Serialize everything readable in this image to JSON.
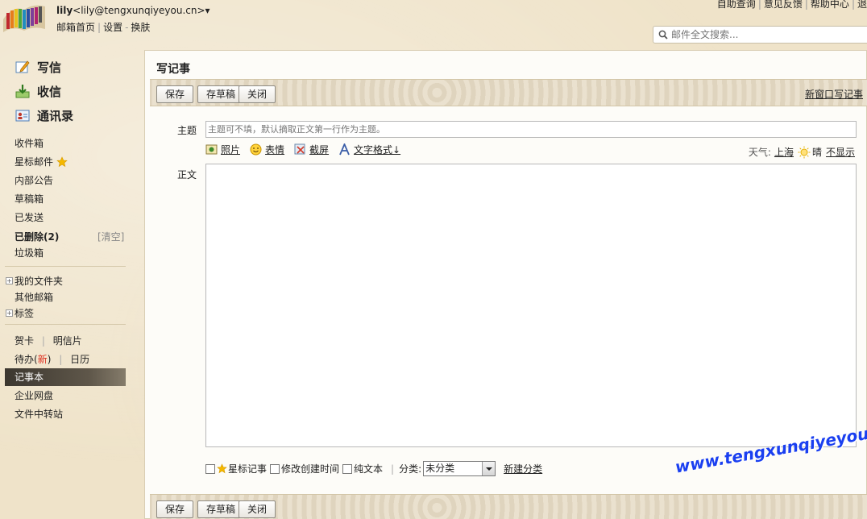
{
  "header": {
    "user_name": "lily",
    "user_email": "<lily@tengxunqiyeyou.cn>",
    "dropdown_glyph": "▾",
    "sub_links": [
      "邮箱首页",
      "设置",
      "换肤"
    ],
    "top_links": [
      "自助查询",
      "意见反馈",
      "帮助中心",
      "退"
    ],
    "search_placeholder": "邮件全文搜索..."
  },
  "sidebar": {
    "main_actions": [
      {
        "label": "写信",
        "icon": "pencil-icon"
      },
      {
        "label": "收信",
        "icon": "inbox-download-icon"
      },
      {
        "label": "通讯录",
        "icon": "contact-card-icon"
      }
    ],
    "folders": [
      "收件箱",
      "星标邮件",
      "内部公告",
      "草稿箱",
      "已发送",
      "已删除(2)",
      "垃圾箱"
    ],
    "clear_label": "[清空]",
    "tree_items": [
      "我的文件夹",
      "其他邮箱",
      "标签"
    ],
    "tree_expand_glyph": "+",
    "apps": {
      "greeting_card": "贺卡",
      "postcard": "明信片",
      "todo": "待办",
      "todo_new": "新",
      "calendar": "日历",
      "notebook": "记事本",
      "netdisk": "企业网盘",
      "transfer": "文件中转站"
    }
  },
  "compose": {
    "title": "写记事",
    "buttons": {
      "save": "保存",
      "draft": "存草稿",
      "close": "关闭"
    },
    "new_window_link": "新窗口写记事",
    "subject_label": "主题",
    "subject_placeholder": "主题可不填，默认摘取正文第一行作为主题。",
    "tools": [
      "照片",
      "表情",
      "截屏",
      "文字格式↓"
    ],
    "weather_label": "天气:",
    "weather_city": "上海",
    "weather_state": "晴",
    "weather_hide": "不显示",
    "body_label": "正文",
    "options": {
      "star_note": "星标记事",
      "modify_time": "修改创建时间",
      "plain_text": "纯文本",
      "category_label": "分类:",
      "category_value": "未分类",
      "new_category": "新建分类"
    }
  },
  "watermark": "www.tengxunqiyeyou.com",
  "colors": {
    "active_nav": "#3c372f",
    "watermark": "#1a3ff0",
    "star": "#f5b800"
  }
}
